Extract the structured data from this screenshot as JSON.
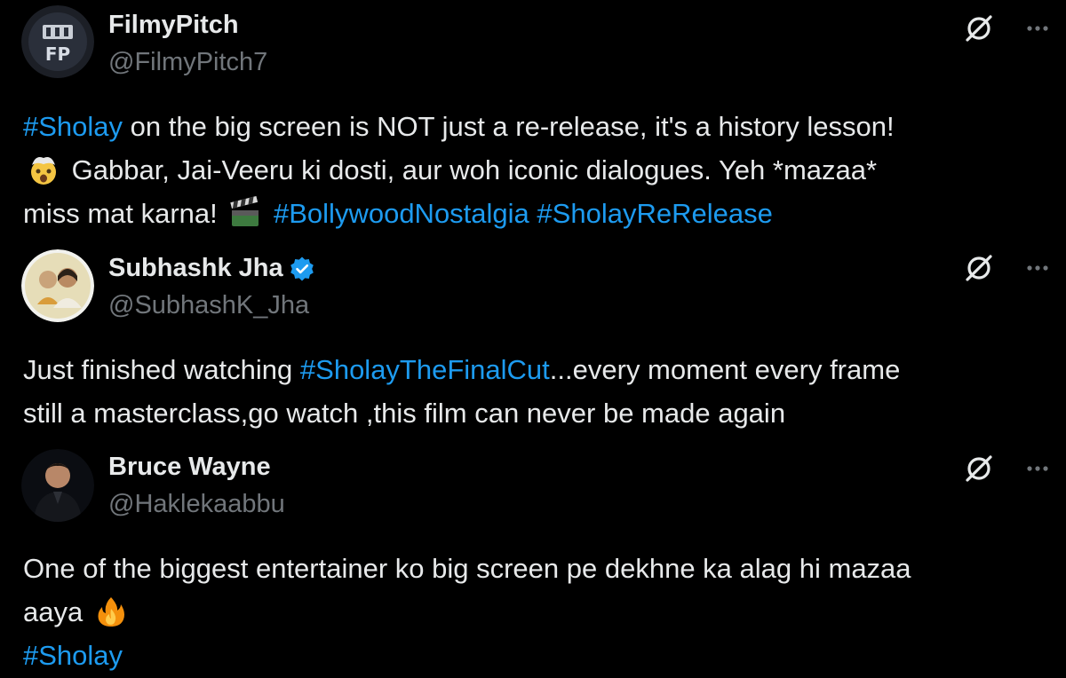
{
  "tweets": [
    {
      "name": "FilmyPitch",
      "handle": "@FilmyPitch7",
      "verified": false,
      "avatar_text": "FP",
      "body": {
        "tag1": "#Sholay",
        "text1": " on the big screen is NOT just a re-release, it's a history lesson!",
        "text2": " Gabbar, Jai-Veeru ki dosti, aur woh iconic dialogues. Yeh *mazaa*",
        "text3": "miss mat karna! ",
        "tag2": "#BollywoodNostalgia",
        "tag3": "#SholayReRelease"
      }
    },
    {
      "name": "Subhashk Jha",
      "handle": "@SubhashK_Jha",
      "verified": true,
      "body": {
        "text1": "Just finished watching ",
        "tag1": "#SholayTheFinalCut",
        "text2": "...every moment every frame",
        "text3": "still a masterclass,go watch ,this film can never be made again"
      }
    },
    {
      "name": "Bruce Wayne",
      "handle": "@Haklekaabbu",
      "verified": false,
      "body": {
        "text1": "One of the biggest entertainer ko big screen pe dekhne ka alag hi mazaa",
        "text2": "aaya ",
        "tag1": "#Sholay"
      }
    }
  ],
  "icons": {
    "grok": "grok-icon",
    "more": "more-dots-icon",
    "verified": "verified-badge-icon",
    "mind_blown_emoji": "mind-blown-emoji-icon",
    "clapper_emoji": "clapper-board-emoji-icon",
    "fire_emoji": "fire-emoji-icon"
  },
  "colors": {
    "background": "#000000",
    "text": "#e7e9ea",
    "secondary": "#71767b",
    "hashtag": "#1d9bf0"
  }
}
